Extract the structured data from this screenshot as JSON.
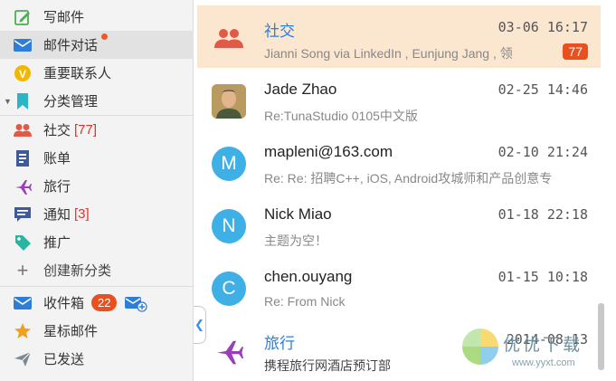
{
  "sidebar": {
    "compose": "写邮件",
    "conversations": "邮件对话",
    "vip": "重要联系人",
    "categories": "分类管理",
    "cat_social": "社交",
    "cat_social_count": "[77]",
    "cat_bills": "账单",
    "cat_travel": "旅行",
    "cat_notify": "通知",
    "cat_notify_count": "[3]",
    "cat_promo": "推广",
    "new_category": "创建新分类",
    "inbox": "收件箱",
    "inbox_count": "22",
    "starred": "星标邮件",
    "sent": "已发送"
  },
  "mails": [
    {
      "name": "社交",
      "date": "03-06 16:17",
      "subject": "Jianni Song via LinkedIn , Eunjung Jang , 领",
      "count": "77"
    },
    {
      "name": "Jade Zhao",
      "date": "02-25 14:46",
      "subject": "Re:TunaStudio 0105中文版"
    },
    {
      "name": "mapleni@163.com",
      "date": "02-10 21:24",
      "subject": "Re: Re: 招聘C++, iOS, Android攻城师和产品创意专",
      "initial": "M"
    },
    {
      "name": "Nick Miao",
      "date": "01-18 22:18",
      "subject": "主题为空！",
      "initial": "N"
    },
    {
      "name": "chen.ouyang",
      "date": "01-15 10:18",
      "subject": "Re: From Nick",
      "initial": "C"
    },
    {
      "name": "旅行",
      "date": "2014-08-13",
      "subject": "携程旅行网酒店预订部"
    }
  ],
  "watermark": {
    "title": "优优下载",
    "url": "www.yyxt.com"
  },
  "colors": {
    "accent": "#2e7ed8",
    "badge": "#e8501f",
    "selected": "#fbe6cf",
    "avatar": "#3fb0e6"
  }
}
